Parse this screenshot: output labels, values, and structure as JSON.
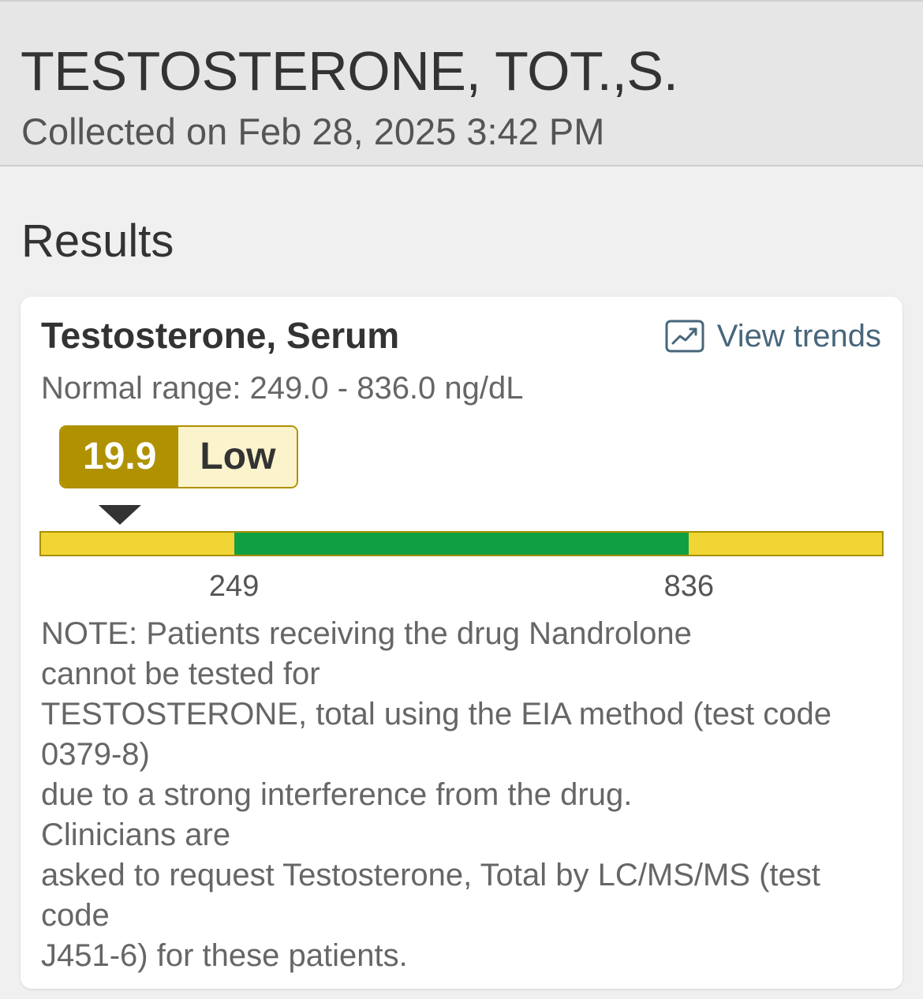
{
  "header": {
    "title": "TESTOSTERONE, TOT.,S.",
    "collected": "Collected on Feb 28, 2025 3:42 PM"
  },
  "results": {
    "heading": "Results"
  },
  "card": {
    "test_name": "Testosterone, Serum",
    "trends_link": {
      "label": "View trends",
      "icon": "trend-chart-icon"
    },
    "normal_range": "Normal range: 249.0 - 836.0 ng/dL",
    "result_value": "19.9",
    "result_status": "Low",
    "range_bar": {
      "scale_min": 0,
      "scale_max": 1085,
      "low_threshold": 249,
      "high_threshold": 836,
      "value": 19.9,
      "ticks": [
        "249",
        "836"
      ]
    },
    "colors": {
      "out_of_range": "#f1d534",
      "in_range": "#11a041",
      "badge_value_bg": "#b09200",
      "badge_status_bg": "#fbf3cc",
      "link": "#47667b"
    },
    "note": "NOTE: Patients receiving the drug Nandrolone\ncannot be tested for\nTESTOSTERONE, total using the EIA method (test code 0379-8)\ndue to a strong interference from the drug.\nClinicians are\nasked to request Testosterone, Total by LC/MS/MS (test code\nJ451-6) for these patients."
  }
}
